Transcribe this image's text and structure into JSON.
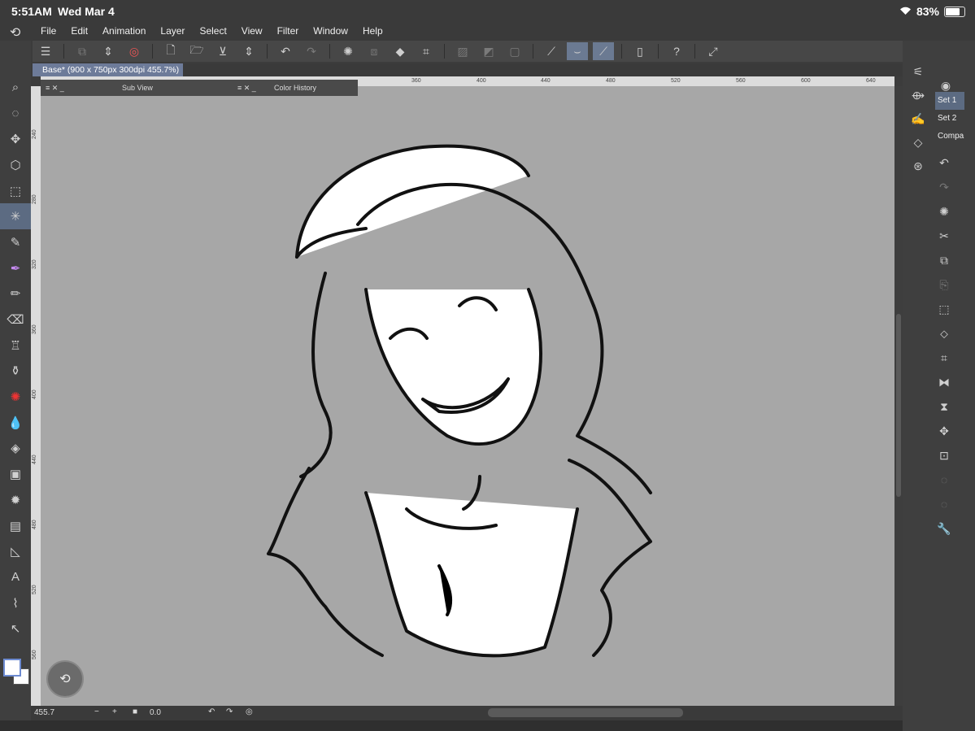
{
  "status": {
    "time": "5:51AM",
    "date": "Wed Mar 4",
    "battery": "83%",
    "battery_level": 0.83
  },
  "menu": {
    "items": [
      "File",
      "Edit",
      "Animation",
      "Layer",
      "Select",
      "View",
      "Filter",
      "Window",
      "Help"
    ]
  },
  "document": {
    "tab": "Base* (900 x 750px 300dpi 455.7%)"
  },
  "panels": {
    "subview": "Sub View",
    "color_history": "Color History"
  },
  "ruler": {
    "top": [
      "360",
      "400",
      "440",
      "480",
      "520",
      "560",
      "600",
      "640"
    ],
    "left": [
      "240",
      "280",
      "320",
      "360",
      "400",
      "440",
      "480",
      "520",
      "560"
    ]
  },
  "bottom": {
    "zoom": "455.7",
    "minus": "−",
    "plus": "+",
    "angle": "0.0"
  },
  "sets": [
    "Set 1",
    "Set 2",
    "Compa"
  ]
}
